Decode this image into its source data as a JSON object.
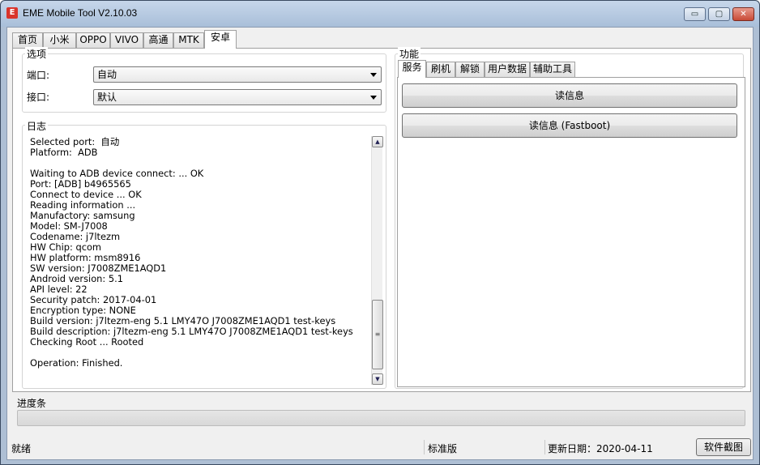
{
  "window": {
    "title": "EME Mobile Tool V2.10.03",
    "app_icon": "E",
    "controls": {
      "minimize": "▭",
      "maximize": "▢",
      "close": "✕"
    }
  },
  "main_tabs": [
    {
      "label": "首页"
    },
    {
      "label": "小米"
    },
    {
      "label": "OPPO"
    },
    {
      "label": "VIVO"
    },
    {
      "label": "高通"
    },
    {
      "label": "MTK"
    },
    {
      "label": "安卓"
    }
  ],
  "active_tab": "安卓",
  "options": {
    "title": "选项",
    "port_label": "端口:",
    "port_value": "自动",
    "interface_label": "接口:",
    "interface_value": "默认"
  },
  "log": {
    "title": "日志",
    "lines": [
      "Selected port:  自动",
      "Platform:  ADB",
      "",
      "Waiting to ADB device connect: ... OK",
      "Port: [ADB] b4965565",
      "Connect to device ... OK",
      "Reading information ...",
      "Manufactory: samsung",
      "Model: SM-J7008",
      "Codename: j7ltezm",
      "HW Chip: qcom",
      "HW platform: msm8916",
      "SW version: J7008ZME1AQD1",
      "Android version: 5.1",
      "API level: 22",
      "Security patch: 2017-04-01",
      "Encryption type: NONE",
      "Build version: j7ltezm-eng 5.1 LMY47O J7008ZME1AQD1 test-keys",
      "Build description: j7ltezm-eng 5.1 LMY47O J7008ZME1AQD1 test-keys",
      "Checking Root ... Rooted",
      "",
      "Operation: Finished."
    ],
    "text": ""
  },
  "functions": {
    "title": "功能",
    "tabs": [
      {
        "label": "服务"
      },
      {
        "label": "刷机"
      },
      {
        "label": "解锁"
      },
      {
        "label": "用户数据"
      },
      {
        "label": "辅助工具"
      }
    ],
    "active_tab": "服务",
    "buttons": {
      "read_info": "读信息",
      "read_info_fastboot": "读信息 (Fastboot)"
    }
  },
  "progress": {
    "label": "进度条",
    "value": 0
  },
  "status": {
    "state": "就绪",
    "edition": "标准版",
    "update_date": "更新日期：2020-04-11",
    "screenshot_button": "软件截图"
  }
}
